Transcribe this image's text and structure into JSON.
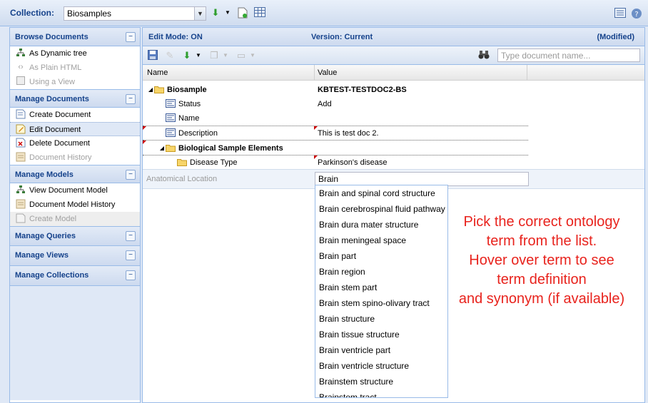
{
  "topbar": {
    "collection_label": "Collection:",
    "collection_value": "Biosamples",
    "icons": [
      "chevron-down-icon",
      "download-icon",
      "new-document-icon",
      "grid-icon",
      "list-icon",
      "help-icon"
    ]
  },
  "sidebar": {
    "sections": {
      "browse": {
        "title": "Browse Documents",
        "items": [
          "As Dynamic tree",
          "As Plain HTML",
          "Using a View"
        ]
      },
      "manage_documents": {
        "title": "Manage Documents",
        "items": [
          "Create Document",
          "Edit Document",
          "Delete Document",
          "Document History"
        ]
      },
      "manage_models": {
        "title": "Manage Models",
        "items": [
          "View Document Model",
          "Document Model History",
          "Create Model"
        ]
      },
      "manage_queries": {
        "title": "Manage Queries"
      },
      "manage_views": {
        "title": "Manage Views"
      },
      "manage_collections": {
        "title": "Manage Collections"
      }
    },
    "collapse_glyph": "−"
  },
  "editor": {
    "mode": "Edit Mode: ON",
    "version": "Version: Current",
    "status": "(Modified)",
    "docname_placeholder": "Type document name...",
    "columns": {
      "name": "Name",
      "value": "Value"
    },
    "rows": {
      "biosample": {
        "name": "Biosample",
        "value": "KBTEST-TESTDOC2-BS"
      },
      "status": {
        "name": "Status",
        "value": "Add"
      },
      "name": {
        "name": "Name",
        "value": ""
      },
      "description": {
        "name": "Description",
        "value": "This is test doc 2."
      },
      "bio_elements": {
        "name": "Biological Sample Elements",
        "value": ""
      },
      "disease_type": {
        "name": "Disease Type",
        "value": "Parkinson's disease"
      }
    },
    "anatomical": {
      "label": "Anatomical Location",
      "value": "Brain"
    }
  },
  "dropdown": [
    "Brain and spinal cord structure",
    "Brain cerebrospinal fluid pathway",
    "Brain dura mater structure",
    "Brain meningeal space",
    "Brain part",
    "Brain region",
    "Brain stem part",
    "Brain stem spino-olivary tract",
    "Brain structure",
    "Brain tissue structure",
    "Brain ventricle part",
    "Brain ventricle structure",
    "Brainstem structure",
    "Brainstem tract"
  ],
  "annotation": {
    "lines": [
      "Pick the correct ontology",
      "term from the list.",
      "Hover over term to see",
      "term definition",
      "and synonym (if available)"
    ],
    "color": "#e8231d"
  }
}
